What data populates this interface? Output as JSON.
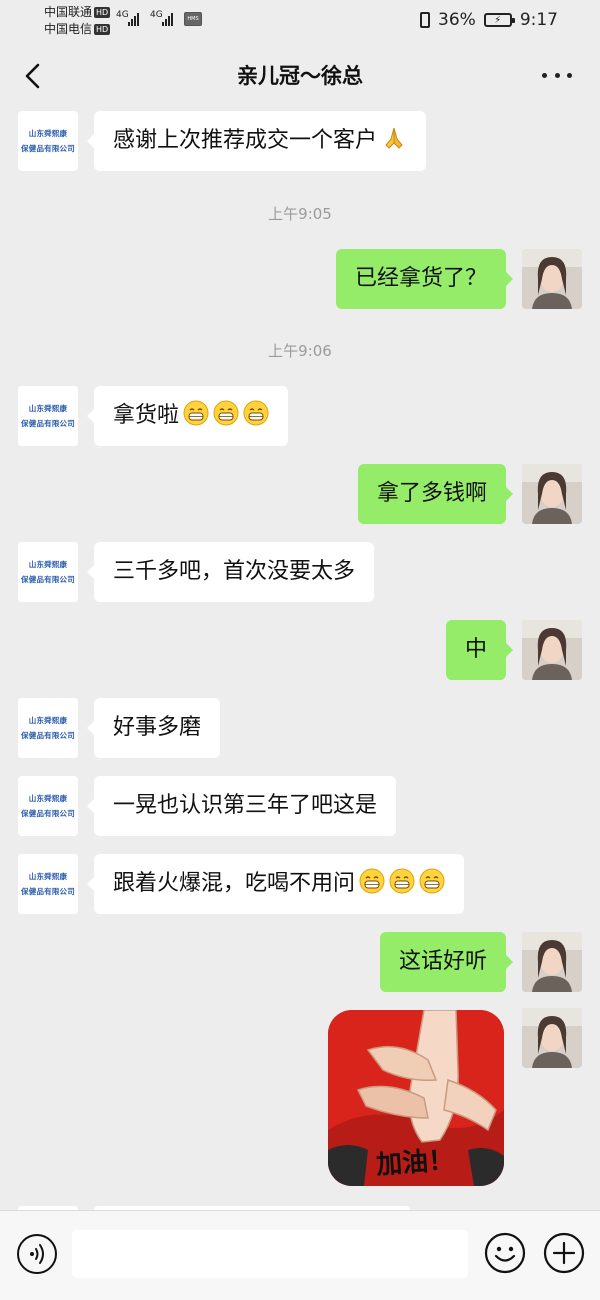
{
  "status_bar": {
    "carrier1": "中国联通",
    "carrier2": "中国电信",
    "hd": "HD",
    "net1": "4G",
    "net2": "4G",
    "hms": "HMS",
    "battery_percent": "36%",
    "time": "9:17"
  },
  "header": {
    "title": "亲儿冠～徐总",
    "back_icon": "chevron-left-icon",
    "more_icon": "more-dots-icon"
  },
  "contact_avatar": {
    "line1": "山东舜熙康",
    "line2": "保健品有限公司"
  },
  "messages": [
    {
      "side": "left",
      "text": "感谢上次推荐成交一个客户",
      "emoji": [
        "folded-hands"
      ]
    },
    {
      "type": "time",
      "text": "上午9:05"
    },
    {
      "side": "right",
      "text": "已经拿货了？"
    },
    {
      "type": "time",
      "text": "上午9:06"
    },
    {
      "side": "left",
      "text": "拿货啦",
      "emoji": [
        "grin",
        "grin",
        "grin"
      ]
    },
    {
      "side": "right",
      "text": "拿了多钱啊"
    },
    {
      "side": "left",
      "text": "三千多吧，首次没要太多"
    },
    {
      "side": "right",
      "text": "中"
    },
    {
      "side": "left",
      "text": "好事多磨"
    },
    {
      "side": "left",
      "text": "一晃也认识第三年了吧这是"
    },
    {
      "side": "left",
      "text": "跟着火爆混，吃喝不用问",
      "emoji": [
        "grin",
        "grin",
        "grin"
      ]
    },
    {
      "side": "right",
      "text": "这话好听"
    },
    {
      "side": "right",
      "type": "sticker",
      "caption": "加油！"
    }
  ],
  "input_bar": {
    "voice_icon": "voice-icon",
    "placeholder": "",
    "emoji_icon": "emoji-face-icon",
    "plus_icon": "plus-circle-icon"
  },
  "colors": {
    "background": "#ededed",
    "sent_bubble": "#95ec69",
    "received_bubble": "#ffffff",
    "timestamp": "#9b9b9b"
  }
}
